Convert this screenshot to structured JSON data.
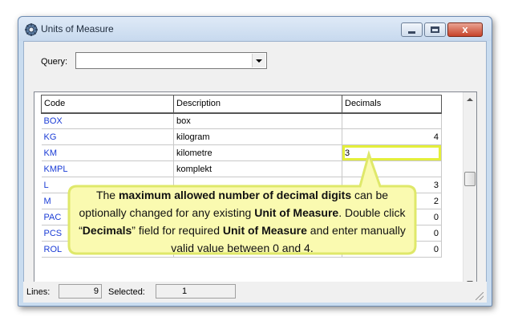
{
  "window": {
    "title": "Units of Measure",
    "close_glyph": "x",
    "accent": "#c7432a"
  },
  "query": {
    "label": "Query:",
    "value": ""
  },
  "grid": {
    "headers": [
      "Code",
      "Description",
      "Decimals"
    ],
    "rows": [
      {
        "code": "BOX",
        "description": "box",
        "decimals": ""
      },
      {
        "code": "KG",
        "description": "kilogram",
        "decimals": "4"
      },
      {
        "code": "KM",
        "description": "kilometre",
        "decimals": "3"
      },
      {
        "code": "KMPL",
        "description": "komplekt",
        "decimals": ""
      },
      {
        "code": "L",
        "description": "",
        "decimals": "3"
      },
      {
        "code": "M",
        "description": "",
        "decimals": "2"
      },
      {
        "code": "PAC",
        "description": "",
        "decimals": "0"
      },
      {
        "code": "PCS",
        "description": "",
        "decimals": "0"
      },
      {
        "code": "ROL",
        "description": "",
        "decimals": "0"
      }
    ],
    "editing_row": 2,
    "code_color": "#1a3cd6"
  },
  "status": {
    "lines_label": "Lines:",
    "lines_value": "9",
    "selected_label": "Selected:",
    "selected_value": "1"
  },
  "callout": {
    "t1": "The ",
    "b1": "maximum allowed number of decimal digits",
    "t2": " can be optionally changed for any existing ",
    "b2": "Unit of Measure",
    "t3": ". Double click “",
    "b3": "Decimals",
    "t4": "” field for required ",
    "b4": "Unit of Measure",
    "t5": " and enter manually valid value between 0 and 4.",
    "fill": "#fafab0",
    "border": "#dfe86a"
  }
}
